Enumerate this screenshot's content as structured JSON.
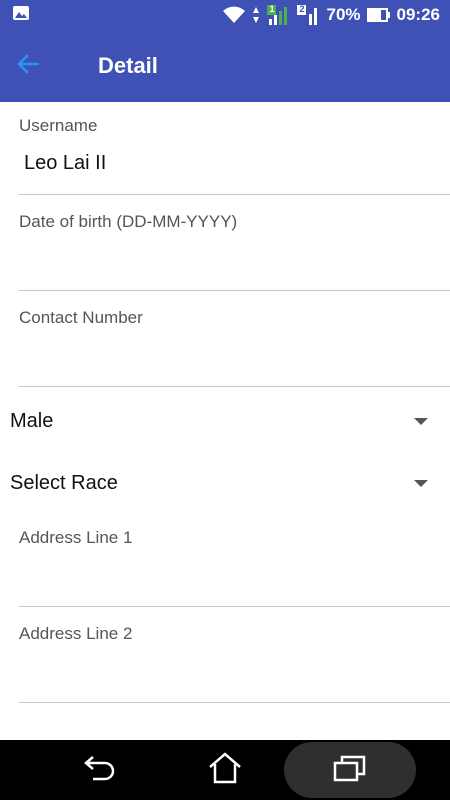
{
  "status_bar": {
    "battery_percent": "70%",
    "time": "09:26",
    "sim1_badge": "1",
    "sim2_badge": "2"
  },
  "app_bar": {
    "title": "Detail"
  },
  "form": {
    "username": {
      "label": "Username",
      "value": "Leo Lai II"
    },
    "dob": {
      "label": "Date of birth (DD-MM-YYYY)",
      "value": ""
    },
    "contact": {
      "label": "Contact Number",
      "value": ""
    },
    "gender": {
      "selected": "Male"
    },
    "race": {
      "selected": "Select Race"
    },
    "address1": {
      "label": "Address Line 1",
      "value": ""
    },
    "address2": {
      "label": "Address Line 2",
      "value": ""
    }
  },
  "icons": {
    "back": "arrow-back-icon",
    "nav_back": "nav-back-icon",
    "nav_home": "nav-home-icon",
    "nav_recent": "nav-recents-icon"
  },
  "colors": {
    "primary": "#3f51b5",
    "back_arrow": "#2196f3",
    "nav_bar": "#000000"
  }
}
